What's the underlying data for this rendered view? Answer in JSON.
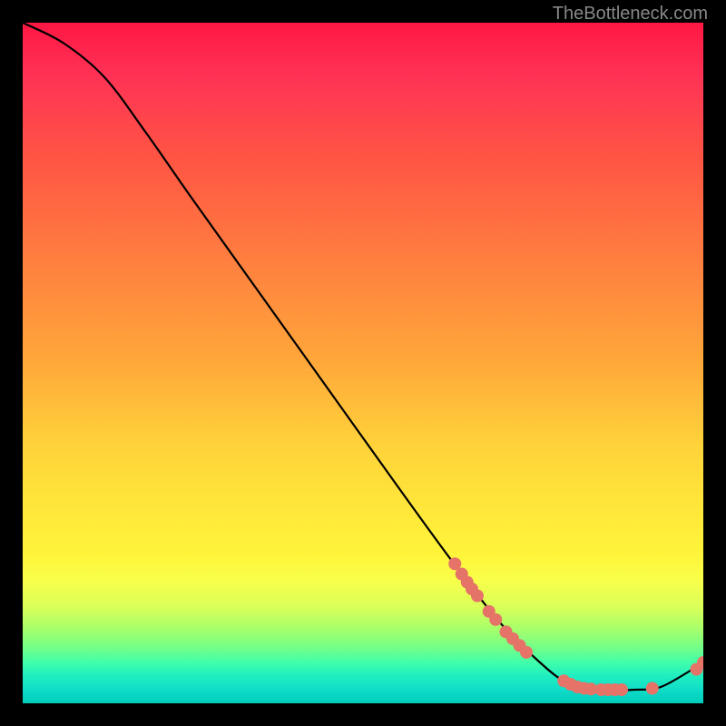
{
  "watermark": "TheBottleneck.com",
  "chart_data": {
    "type": "line",
    "title": "",
    "xlabel": "",
    "ylabel": "",
    "xlim": [
      0,
      100
    ],
    "ylim": [
      0,
      100
    ],
    "curve": {
      "name": "bottleneck-curve",
      "points": [
        {
          "x": 0,
          "y": 100
        },
        {
          "x": 6,
          "y": 97
        },
        {
          "x": 12,
          "y": 92
        },
        {
          "x": 18,
          "y": 84
        },
        {
          "x": 25,
          "y": 74
        },
        {
          "x": 35,
          "y": 60
        },
        {
          "x": 45,
          "y": 46
        },
        {
          "x": 55,
          "y": 32
        },
        {
          "x": 63,
          "y": 21
        },
        {
          "x": 70,
          "y": 12
        },
        {
          "x": 76,
          "y": 6
        },
        {
          "x": 80,
          "y": 3
        },
        {
          "x": 84,
          "y": 2
        },
        {
          "x": 90,
          "y": 2
        },
        {
          "x": 94,
          "y": 2.5
        },
        {
          "x": 100,
          "y": 6
        }
      ]
    },
    "markers": [
      {
        "x": 63.5,
        "y": 20.5
      },
      {
        "x": 64.5,
        "y": 19.0
      },
      {
        "x": 65.3,
        "y": 17.8
      },
      {
        "x": 66.0,
        "y": 16.8
      },
      {
        "x": 66.8,
        "y": 15.8
      },
      {
        "x": 68.5,
        "y": 13.5
      },
      {
        "x": 69.5,
        "y": 12.3
      },
      {
        "x": 71.0,
        "y": 10.5
      },
      {
        "x": 72.0,
        "y": 9.5
      },
      {
        "x": 73.0,
        "y": 8.5
      },
      {
        "x": 74.0,
        "y": 7.5
      },
      {
        "x": 79.5,
        "y": 3.3
      },
      {
        "x": 80.5,
        "y": 2.8
      },
      {
        "x": 81.5,
        "y": 2.4
      },
      {
        "x": 82.5,
        "y": 2.2
      },
      {
        "x": 83.5,
        "y": 2.1
      },
      {
        "x": 85.0,
        "y": 2.0
      },
      {
        "x": 86.0,
        "y": 2.0
      },
      {
        "x": 87.0,
        "y": 2.0
      },
      {
        "x": 88.0,
        "y": 2.0
      },
      {
        "x": 92.5,
        "y": 2.2
      },
      {
        "x": 99.0,
        "y": 5.0
      },
      {
        "x": 100.0,
        "y": 6.0
      }
    ]
  }
}
